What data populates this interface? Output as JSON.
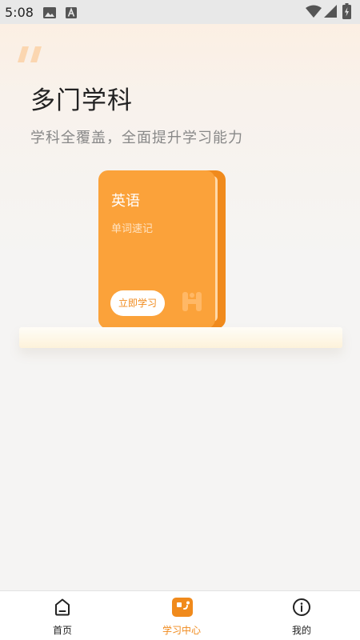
{
  "status_bar": {
    "time": "5:08",
    "icons": [
      "image-icon",
      "a-badge-icon",
      "wifi-icon",
      "signal-icon",
      "battery-icon"
    ]
  },
  "header": {
    "quote_icon": "quote-mark-icon",
    "title": "多门学科",
    "subtitle": "学科全覆盖，全面提升学习能力"
  },
  "book": {
    "title": "英语",
    "subtitle": "单词速记",
    "button_label": "立即学习",
    "cover_color": "#fba23a",
    "watermark_icon": "h-logo-icon"
  },
  "tab_bar": {
    "active_color": "#f08a1c",
    "tabs": [
      {
        "label": "首页",
        "icon": "home-icon",
        "active": false
      },
      {
        "label": "学习中心",
        "icon": "study-center-icon",
        "active": true
      },
      {
        "label": "我的",
        "icon": "profile-icon",
        "active": false
      }
    ]
  }
}
